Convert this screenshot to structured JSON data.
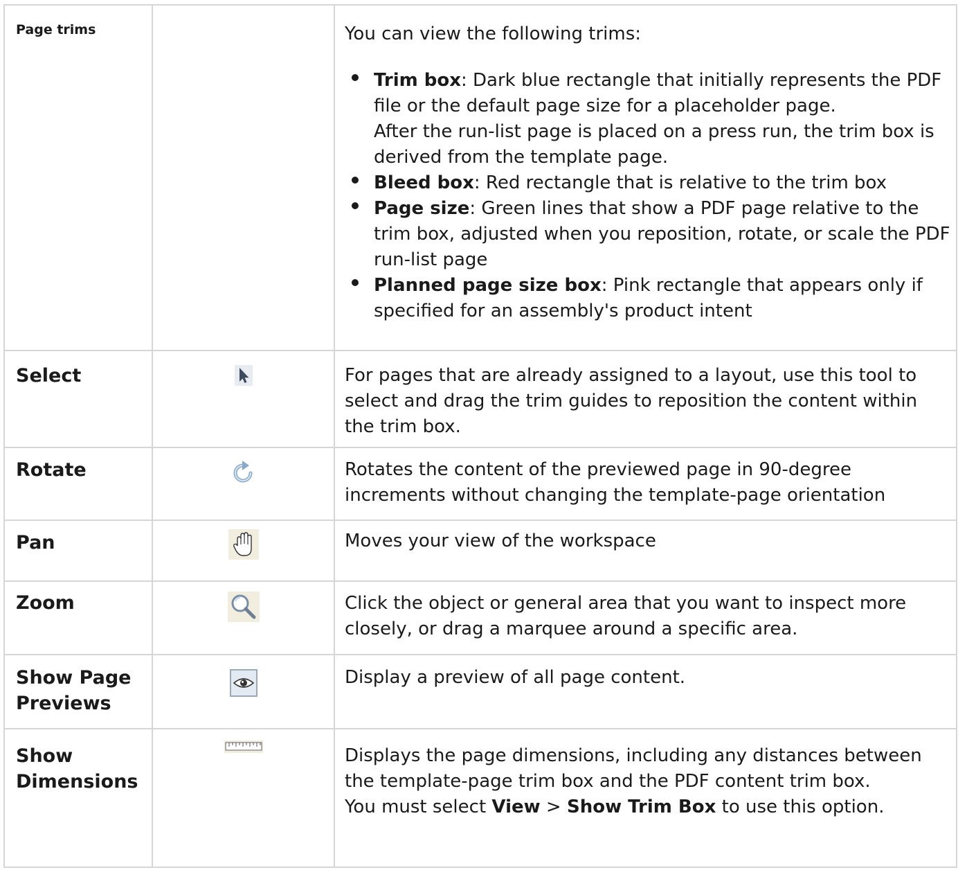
{
  "rows": {
    "page_trims": {
      "name": "Page trims",
      "intro": "You can view the following trims:",
      "items": [
        {
          "term": "Trim box",
          "text": ": Dark blue rectangle that initially represents the PDF file or the default page size for a placeholder page.",
          "extra": "After the run-list page is placed on a press run, the trim box is derived from the template page."
        },
        {
          "term": "Bleed box",
          "text": ": Red rectangle that is relative to the trim box"
        },
        {
          "term": "Page size",
          "text": ": Green lines that show a PDF page relative to the trim box, adjusted when you reposition, rotate, or scale the PDF run-list page"
        },
        {
          "term": "Planned page size box",
          "text": ": Pink rectangle that appears only if specified for an assembly's product intent"
        }
      ]
    },
    "select": {
      "name": "Select",
      "icon": "arrow-pointer-icon",
      "desc": "For pages that are already assigned to a layout, use this tool to select and drag the trim guides to reposition the content within the trim box."
    },
    "rotate": {
      "name": "Rotate",
      "icon": "rotate-clockwise-icon",
      "desc": "Rotates the content of the previewed page in 90-degree increments without changing the template-page orientation"
    },
    "pan": {
      "name": "Pan",
      "icon": "hand-icon",
      "desc": "Moves your view of the workspace"
    },
    "zoom": {
      "name": "Zoom",
      "icon": "magnifier-icon",
      "desc": "Click the object or general area that you want to inspect more closely, or drag a marquee around a specific area."
    },
    "previews": {
      "name": "Show Page Previews",
      "icon": "eye-icon",
      "desc": "Display a preview of all page content."
    },
    "dimensions": {
      "name": "Show Dimensions",
      "icon": "ruler-icon",
      "desc": "Displays the page dimensions, including any distances between the template-page trim box and the PDF content trim box.",
      "note_prefix": "You must select ",
      "note_view": "View",
      "note_sep": " > ",
      "note_menu": "Show Trim Box",
      "note_suffix": " to use this option."
    }
  }
}
